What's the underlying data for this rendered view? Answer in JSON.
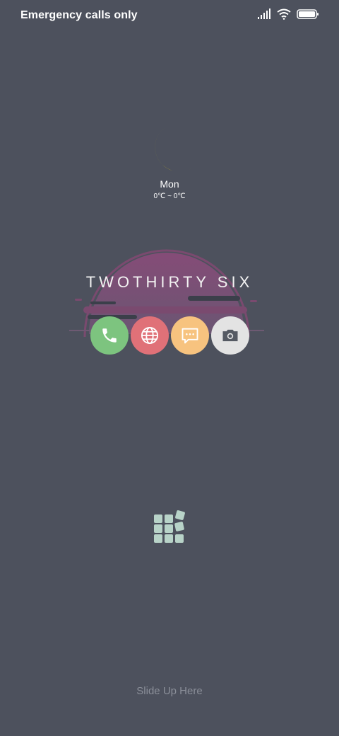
{
  "status_bar": {
    "carrier_text": "Emergency calls only",
    "icons": [
      "signal-icon",
      "wifi-icon",
      "battery-icon"
    ],
    "battery_level": 1.0
  },
  "weather": {
    "icon": "moon-icon",
    "day": "Mon",
    "temperature": "0℃ ~ 0℃",
    "icon_color": "#ffe600"
  },
  "clock": {
    "text": "TWOTHIRTY SIX",
    "accent_color": "#8f4b7c"
  },
  "dock": {
    "apps": [
      {
        "name": "phone",
        "icon": "phone-icon",
        "color": "#7dc47f"
      },
      {
        "name": "browser",
        "icon": "globe-icon",
        "color": "#e07178"
      },
      {
        "name": "messages",
        "icon": "message-icon",
        "color": "#f7c37f"
      },
      {
        "name": "camera",
        "icon": "camera-icon",
        "color": "#e3e3e3"
      }
    ]
  },
  "app_drawer": {
    "icon": "app-grid-icon",
    "color": "#b8d3c8"
  },
  "unlock": {
    "hint": "Slide Up Here"
  }
}
